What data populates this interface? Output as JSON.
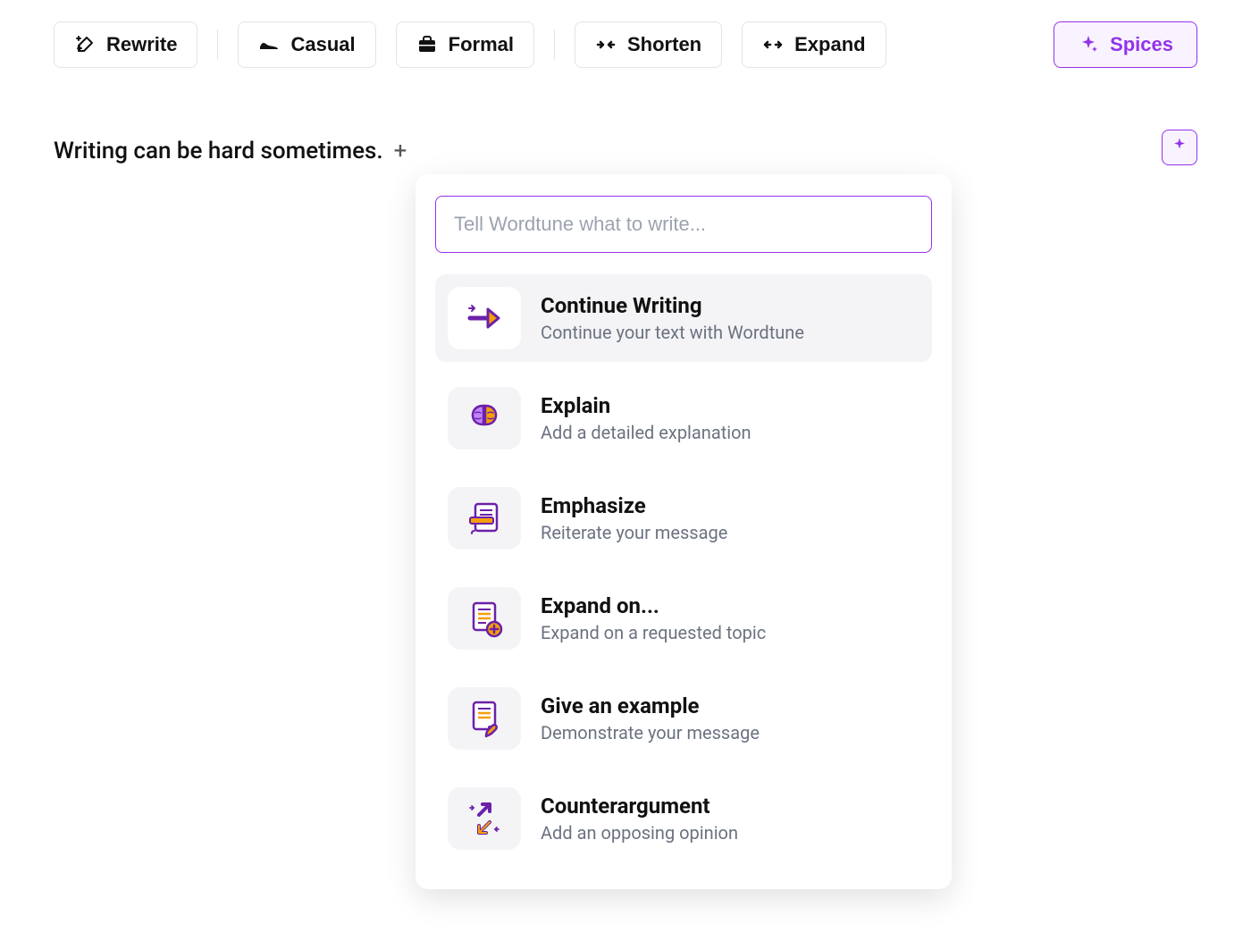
{
  "toolbar": {
    "rewrite": "Rewrite",
    "casual": "Casual",
    "formal": "Formal",
    "shorten": "Shorten",
    "expand": "Expand",
    "spices": "Spices"
  },
  "editor": {
    "text": "Writing can be hard sometimes.",
    "insert_symbol": "+"
  },
  "popup": {
    "placeholder": "Tell Wordtune what to write...",
    "items": [
      {
        "title": "Continue Writing",
        "sub": "Continue your text with Wordtune",
        "icon": "arrow"
      },
      {
        "title": "Explain",
        "sub": "Add a detailed explanation",
        "icon": "brain"
      },
      {
        "title": "Emphasize",
        "sub": "Reiterate your message",
        "icon": "emphasize"
      },
      {
        "title": "Expand on...",
        "sub": "Expand on a requested topic",
        "icon": "expanddoc"
      },
      {
        "title": "Give an example",
        "sub": "Demonstrate your message",
        "icon": "example"
      },
      {
        "title": "Counterargument",
        "sub": "Add an opposing opinion",
        "icon": "counter"
      }
    ],
    "active_index": 0
  }
}
